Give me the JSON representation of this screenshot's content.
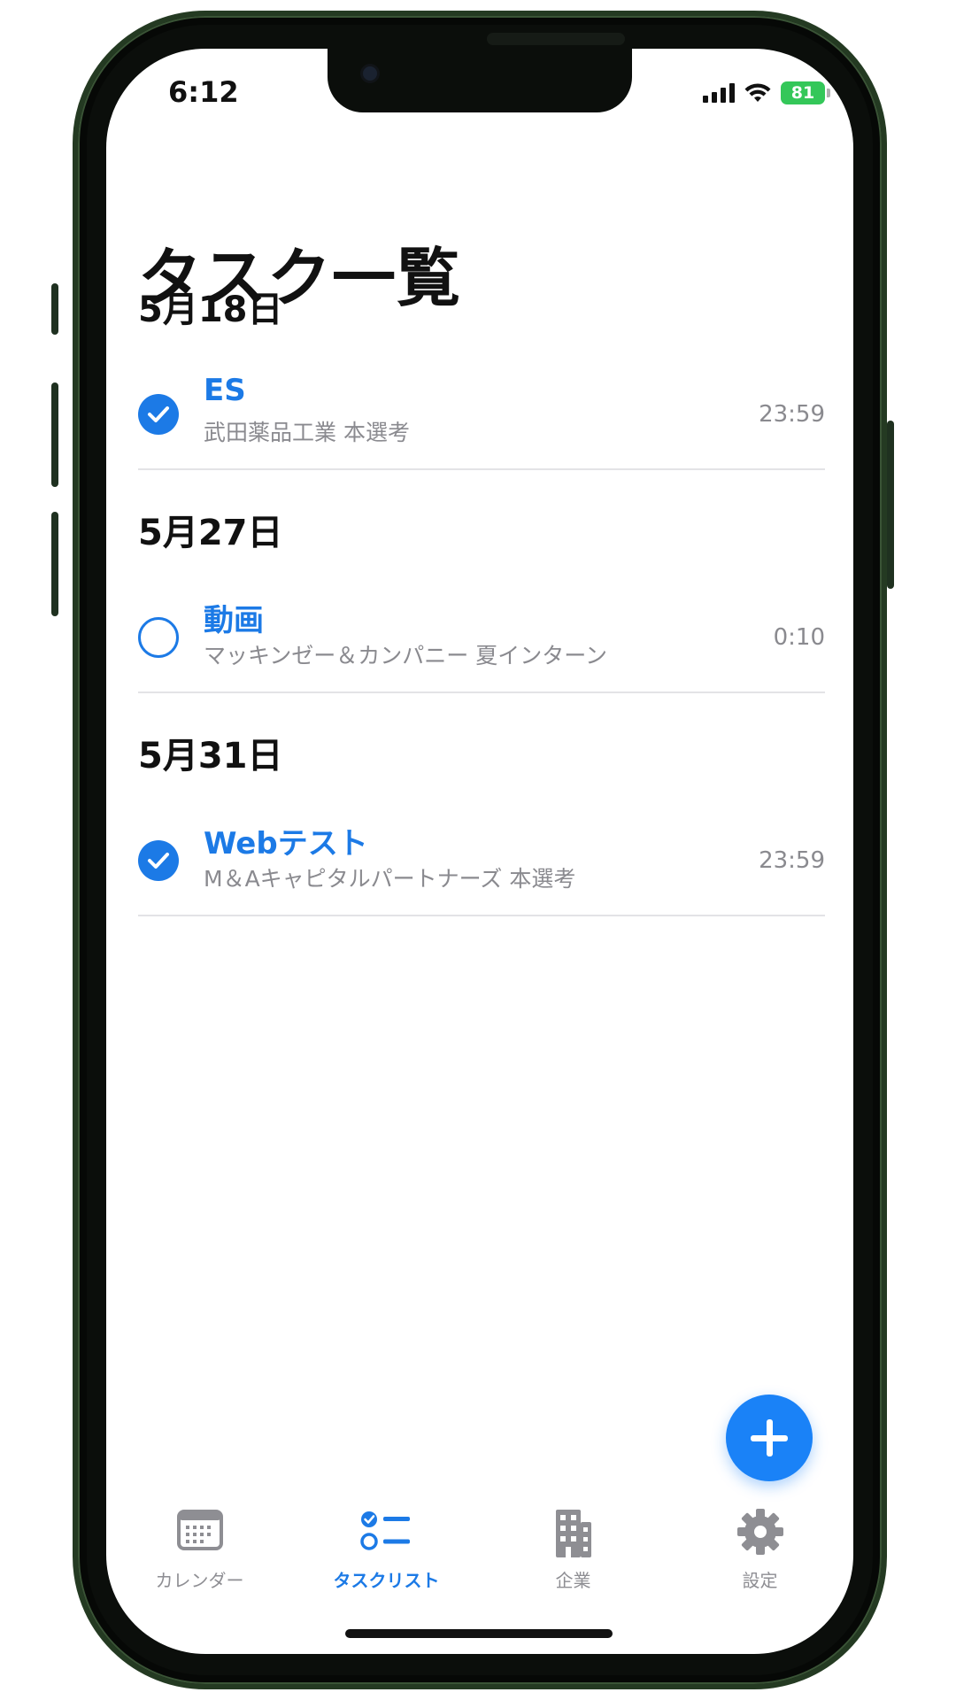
{
  "status_bar": {
    "time": "6:12",
    "battery": "81"
  },
  "page": {
    "title": "タスク一覧"
  },
  "sections": [
    {
      "date": "5月18日",
      "tasks": [
        {
          "title": "ES",
          "subtitle": "武田薬品工業 本選考",
          "time": "23:59",
          "completed": true
        }
      ]
    },
    {
      "date": "5月27日",
      "tasks": [
        {
          "title": "動画",
          "subtitle": "マッキンゼー＆カンパニー 夏インターン",
          "time": "0:10",
          "completed": false
        }
      ]
    },
    {
      "date": "5月31日",
      "tasks": [
        {
          "title": "Webテスト",
          "subtitle": "M＆Aキャピタルパートナーズ 本選考",
          "time": "23:59",
          "completed": true
        }
      ]
    }
  ],
  "tabbar": {
    "items": [
      {
        "label": "カレンダー",
        "icon": "calendar-icon",
        "active": false
      },
      {
        "label": "タスクリスト",
        "icon": "task-list-icon",
        "active": true
      },
      {
        "label": "企業",
        "icon": "building-icon",
        "active": false
      },
      {
        "label": "設定",
        "icon": "gear-icon",
        "active": false
      }
    ]
  },
  "colors": {
    "accent": "#1c7ae6",
    "fab": "#1a82f7",
    "secondary_text": "#8a8a8f",
    "battery": "#34c759"
  }
}
